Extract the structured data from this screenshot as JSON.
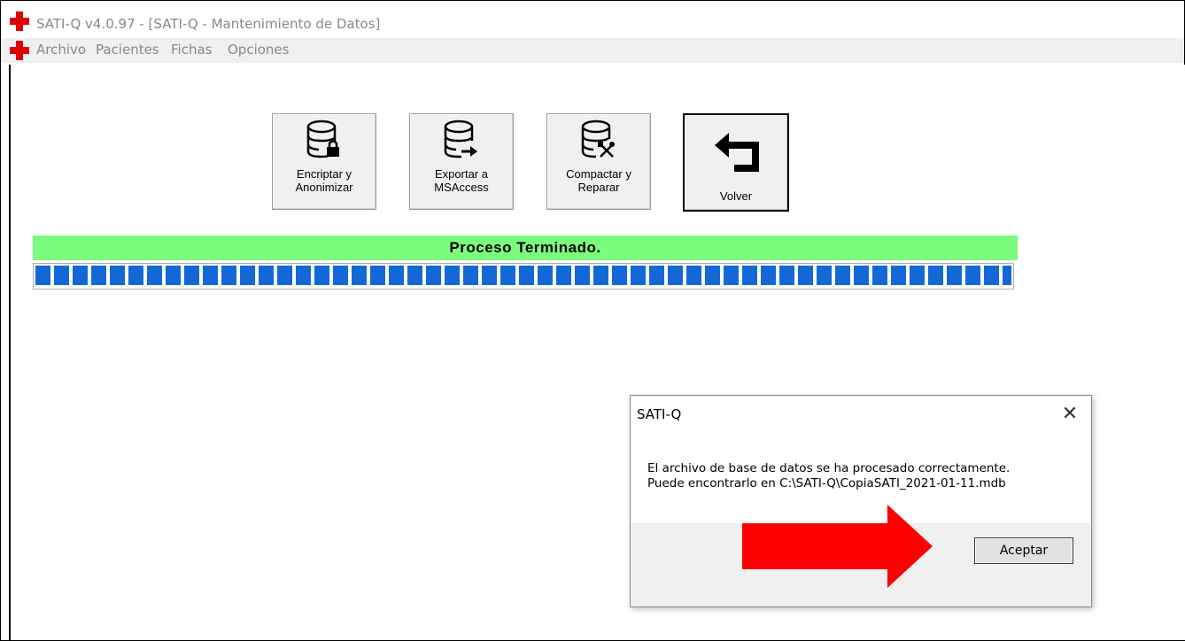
{
  "window": {
    "title": "SATI-Q  v4.0.97 - [SATI-Q - Mantenimiento de Datos]"
  },
  "menu": {
    "items": [
      "Archivo",
      "Pacientes",
      "Fichas",
      "Opciones"
    ]
  },
  "toolbar": {
    "buttons": [
      {
        "line1": "Encriptar y",
        "line2": "Anonimizar",
        "icon": "database-lock-icon"
      },
      {
        "line1": "Exportar a",
        "line2": "MSAccess",
        "icon": "database-export-icon"
      },
      {
        "line1": "Compactar y",
        "line2": "Reparar",
        "icon": "database-tools-icon"
      },
      {
        "line1": "Volver",
        "icon": "return-arrow-icon"
      }
    ]
  },
  "status": {
    "text": "Proceso Terminado.",
    "color": "#7cfc7c"
  },
  "progress": {
    "value": 1.0,
    "color": "#1468d6"
  },
  "dialog": {
    "title": "SATI-Q",
    "message_line1": "El archivo de base de datos se ha procesado correctamente.",
    "message_line2": "Puede encontrarlo en C:\\SATI-Q\\CopiaSATI_2021-01-11.mdb",
    "ok_label": "Aceptar"
  },
  "annotation": {
    "color": "#ff0000",
    "icon": "red-arrow-right"
  }
}
